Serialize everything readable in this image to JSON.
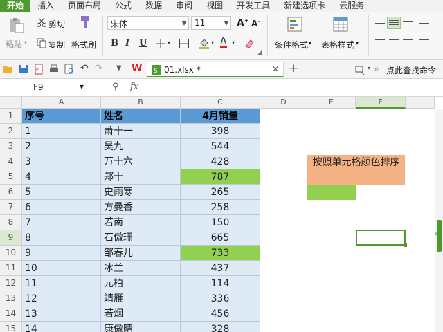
{
  "ribbon_tabs": [
    "开始",
    "插入",
    "页面布局",
    "公式",
    "数据",
    "审阅",
    "视图",
    "开发工具",
    "新建选项卡",
    "云服务"
  ],
  "clipboard": {
    "paste": "粘贴",
    "cut": "剪切",
    "copy": "复制",
    "format_painter": "格式刷"
  },
  "font": {
    "family": "宋体",
    "size": "11",
    "bold": "B",
    "italic": "I",
    "underline": "U"
  },
  "styles": {
    "conditional_format": "条件格式",
    "table_style": "表格样式"
  },
  "document": {
    "tab_name": "01.xlsx *"
  },
  "search_command": "点此查找命令",
  "formula_bar": {
    "cell_ref": "F9",
    "fx": "fx",
    "value": ""
  },
  "columns": [
    "A",
    "B",
    "C",
    "D",
    "E",
    "F"
  ],
  "rows": [
    "1",
    "2",
    "3",
    "4",
    "5",
    "6",
    "7",
    "8",
    "9",
    "10",
    "11",
    "12",
    "13",
    "14",
    "15"
  ],
  "table": {
    "header": {
      "seq": "序号",
      "name": "姓名",
      "sales": "4月销量"
    },
    "rows": [
      {
        "seq": "1",
        "name": "萧十一",
        "sales": "398",
        "highlight": false
      },
      {
        "seq": "2",
        "name": "吴九",
        "sales": "544",
        "highlight": false
      },
      {
        "seq": "3",
        "name": "万十六",
        "sales": "428",
        "highlight": false
      },
      {
        "seq": "4",
        "name": "郑十",
        "sales": "787",
        "highlight": true
      },
      {
        "seq": "5",
        "name": "史雨寒",
        "sales": "265",
        "highlight": false
      },
      {
        "seq": "6",
        "name": "方曼香",
        "sales": "258",
        "highlight": false
      },
      {
        "seq": "7",
        "name": "若南",
        "sales": "150",
        "highlight": false
      },
      {
        "seq": "8",
        "name": "石傲珊",
        "sales": "665",
        "highlight": false
      },
      {
        "seq": "9",
        "name": "邹春儿",
        "sales": "733",
        "highlight": true
      },
      {
        "seq": "10",
        "name": "冰兰",
        "sales": "437",
        "highlight": false
      },
      {
        "seq": "11",
        "name": "元柏",
        "sales": "114",
        "highlight": false
      },
      {
        "seq": "12",
        "name": "靖雁",
        "sales": "336",
        "highlight": false
      },
      {
        "seq": "13",
        "name": "若烟",
        "sales": "456",
        "highlight": false
      },
      {
        "seq": "14",
        "name": "康傲晴",
        "sales": "328",
        "highlight": false
      }
    ]
  },
  "note_text": "按照单元格颜色排序",
  "colors": {
    "accent": "#4e9a2e",
    "header_fill": "#5b9bd5",
    "body_fill": "#deebf7",
    "highlight_fill": "#92d050",
    "note_fill": "#f4b183"
  }
}
